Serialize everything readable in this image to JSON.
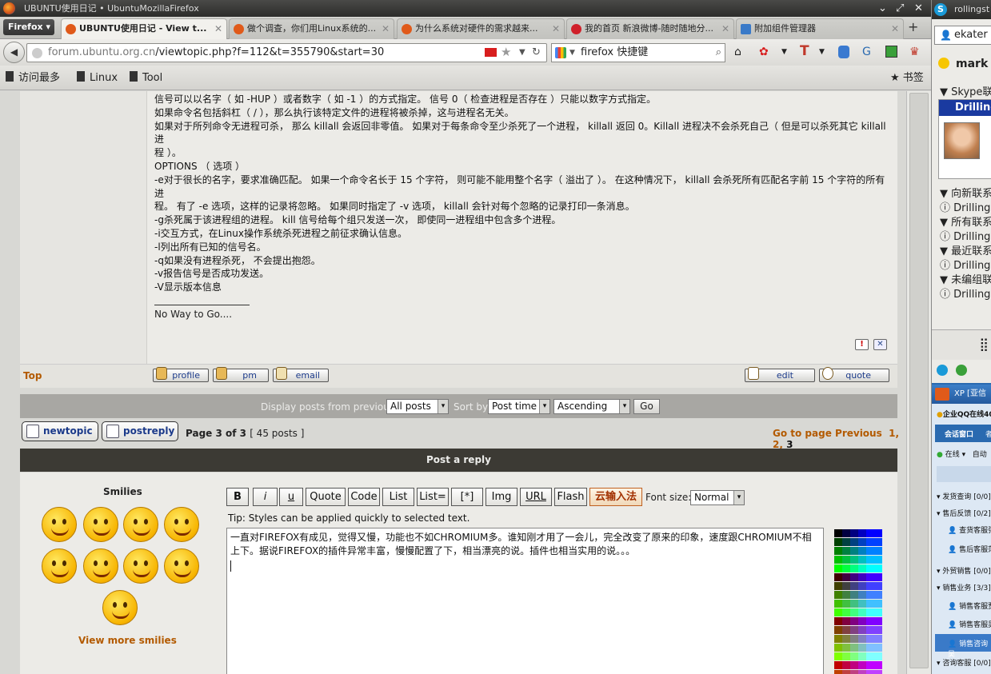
{
  "window": {
    "title": "UBUNTU使用日记 • UbuntuMozillaFirefox"
  },
  "firefox_menu": "Firefox",
  "tabs": [
    {
      "label": "UBUNTU使用日记 - View t...",
      "active": true
    },
    {
      "label": "做个调查，你们用Linux系统的...",
      "active": false
    },
    {
      "label": "为什么系统对硬件的需求越来...",
      "active": false
    },
    {
      "label": "我的首页 新浪微博-随时随地分...",
      "active": false
    },
    {
      "label": "附加组件管理器",
      "active": false
    }
  ],
  "url": {
    "host": "forum.ubuntu.org.cn",
    "path": "/viewtopic.php?f=112&t=355790&start=30"
  },
  "search": {
    "engine_text": "firefox 快捷键"
  },
  "bookmarks": {
    "items": [
      "访问最多",
      "Linux",
      "Tool"
    ],
    "right": "书签"
  },
  "post": {
    "lines": [
      "信号可以以名字（ 如 -HUP ）或者数字（ 如 -1 ）的方式指定。 信号 0（ 检查进程是否存在 ）只能以数字方式指定。",
      "如果命令名包括斜杠（ / ），那么执行该特定文件的进程将被杀掉，这与进程名无关。",
      "如果对于所列命令无进程可杀， 那么 killall 会返回非零值。 如果对于每条命令至少杀死了一个进程， killall 返回 0。Killall 进程决不会杀死自己（ 但是可以杀死其它 killall 进",
      "程 ）。",
      "OPTIONS （ 选项 ）",
      "-e对于很长的名字，要求准确匹配。 如果一个命令名长于 15 个字符， 则可能不能用整个名字（ 溢出了 ）。 在这种情况下， killall 会杀死所有匹配名字前 15 个字符的所有进",
      "程。 有了 -e 选项，这样的记录将忽略。 如果同时指定了 -v 选项， killall 会针对每个忽略的记录打印一条消息。",
      "-g杀死属于该进程组的进程。 kill 信号给每个组只发送一次， 即使同一进程组中包含多个进程。",
      "-i交互方式，在Linux操作系统杀死进程之前征求确认信息。",
      "-l列出所有已知的信号名。",
      "-q如果没有进程杀死， 不会提出抱怨。",
      "-v报告信号是否成功发送。",
      "-V显示版本信息"
    ],
    "signature": "No Way to Go....",
    "top_link": "Top",
    "buttons": {
      "profile": "profile",
      "pm": "pm",
      "email": "email",
      "edit": "edit",
      "quote": "quote"
    }
  },
  "display": {
    "label": "Display posts from previous:",
    "posts": "All posts",
    "sortby_label": "Sort by",
    "sortby": "Post time",
    "order": "Ascending",
    "go": "Go"
  },
  "pagination": {
    "newtopic": "newtopic",
    "postreply": "postreply",
    "page_label": "Page 3 of 3",
    "posts_count": "[ 45 posts ]",
    "goto": "Go to page Previous",
    "p1": "1",
    "p2": "2",
    "p3": "3"
  },
  "reply": {
    "bar_title": "Post a reply",
    "smilies_title": "Smilies",
    "more_smilies": "View more smilies",
    "format_buttons": [
      "B",
      "i",
      "u",
      "Quote",
      "Code",
      "List",
      "List=",
      "[*]",
      "Img",
      "URL",
      "Flash",
      "云输入法"
    ],
    "font_size_label": "Font size:",
    "font_size_value": "Normal",
    "tip": "Tip: Styles can be applied quickly to selected text.",
    "text_line1": "一直对FIREFOX有成见，觉得又慢，功能也不如CHROMIUM多。谁知刚才用了一会儿，完全改变了原来的印象，速度跟CHROMIUM不相",
    "text_line2": "上下。据说FIREFOX的插件异常丰富，慢慢配置了下，相当漂亮的说。插件也相当实用的说。。。"
  },
  "skype": {
    "title": "rollingst",
    "user": "ekater",
    "mark": "mark",
    "group1": "Skype联",
    "contact": "Drilling",
    "groups": [
      "向新联系",
      "所有联系",
      "最近联系",
      "未编组联"
    ]
  },
  "qq": {
    "title": "XP [亚信",
    "company": "企业QQ在线400",
    "tabs": [
      "会话窗口",
      "者"
    ],
    "status": "在线",
    "status2": "自动",
    "items": [
      "发货查询 [0/0]",
      "售后反馈 [0/2]",
      "查货客服张",
      "售后客服范",
      "外贸销售 [0/0]",
      "销售业务 [3/3]",
      "销售客服贾",
      "销售客服吴",
      "销售咨询吴",
      "咨询客服 [0/0]"
    ]
  },
  "colors": {
    "accent_orange": "#b35a00",
    "link_blue": "#1b3a8a",
    "dark_bar": "#3c3a34"
  }
}
